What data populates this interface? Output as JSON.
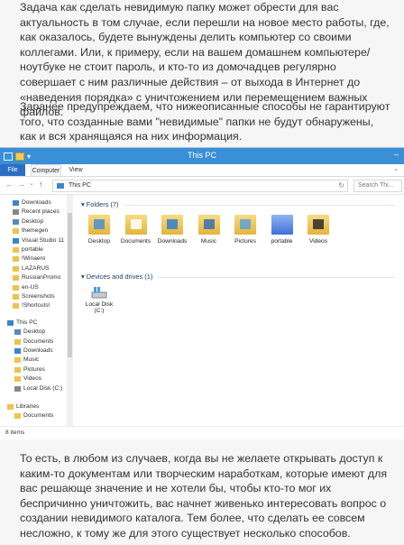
{
  "paragraphs": {
    "p1": "Задача как сделать невидимую папку может обрести для вас актуальность в том случае, если перешли на новое место работы, где, как оказалось, будете вынуждены делить компьютер со своими коллегами. Или, к примеру, если на вашем домашнем компьютере/ноутбуке не стоит пароль, и кто-то из домочадцев регулярно совершает с ним различные действия – от выхода в Интернет до «наведения порядка» с уничтожением или перемещением важных файлов.",
    "p2": "Заранее предупреждаем, что нижеописанные способы не гарантируют того, что созданные вами \"невидимые\" папки не будут обнаружены, как и вся хранящаяся на них информация.",
    "p3": "То есть, в любом из случаев, когда вы не желаете открывать доступ к каким-то документам или творческим наработкам, которые имеют для вас решающе значение и не хотели бы, чтобы кто-то мог их беспричинно уничтожить, вас начнет живенько интересовать вопрос о создании невидимого каталога. Тем более, что сделать ее совсем несложно, к тому же для этого существует несколько способов."
  },
  "window": {
    "title": "This PC",
    "quick_access_dropdown": "▾",
    "minimize_glyph": "–"
  },
  "ribbon": {
    "tabs": [
      "File",
      "Computer",
      "View"
    ],
    "expand_glyph": "⌄"
  },
  "navbar": {
    "back": "←",
    "forward": "→",
    "dropdown": "⌄",
    "up": "↑",
    "address": "This PC",
    "refresh": "↻",
    "search_placeholder": "Search Thi...",
    "search_icon": "magnifier-icon"
  },
  "nav_pane": {
    "favorites": [
      "Downloads",
      "Recent places",
      "Desktop",
      "themegen",
      "Visual Studio 11",
      "portable",
      "!Winaero",
      "LAZARUS",
      "RussianPromo",
      "en-US",
      "Screenshots",
      "!Shortcuts!"
    ],
    "this_pc_label": "This PC",
    "this_pc_items": [
      "Desktop",
      "Documents",
      "Downloads",
      "Music",
      "Pictures",
      "Videos",
      "Local Disk (C:)"
    ],
    "libraries_label": "Libraries",
    "libraries_items": [
      "Documents"
    ]
  },
  "content": {
    "folders_header": "Folders (7)",
    "folders": [
      {
        "label": "Desktop",
        "icon": "desktop-folder-icon"
      },
      {
        "label": "Documents",
        "icon": "documents-folder-icon"
      },
      {
        "label": "Downloads",
        "icon": "downloads-folder-icon"
      },
      {
        "label": "Music",
        "icon": "music-folder-icon"
      },
      {
        "label": "Pictures",
        "icon": "pictures-folder-icon"
      },
      {
        "label": "portable",
        "icon": "portable-folder-icon"
      },
      {
        "label": "Videos",
        "icon": "videos-folder-icon"
      }
    ],
    "devices_header": "Devices and drives (1)",
    "drives": [
      {
        "label_line1": "Local Disk",
        "label_line2": "(C:)",
        "icon": "hard-drive-icon"
      }
    ]
  },
  "status": {
    "text": "8 items"
  },
  "colors": {
    "titlebar": "#3a8fd6",
    "file_tab": "#2b6fc4",
    "folder": "#f0c24c",
    "section_header": "#1e3c6e"
  }
}
